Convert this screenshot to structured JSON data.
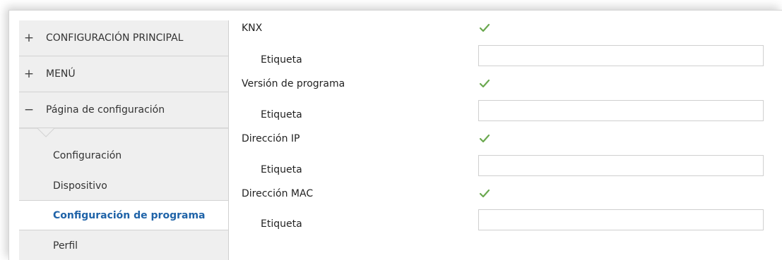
{
  "sidebar": {
    "groups": [
      {
        "sign": "+",
        "label": "CONFIGURACIÓN PRINCIPAL"
      },
      {
        "sign": "+",
        "label": "MENÚ"
      },
      {
        "sign": "−",
        "label": "Página de configuración"
      }
    ],
    "items": [
      {
        "label": "Configuración"
      },
      {
        "label": "Dispositivo"
      },
      {
        "label": "Configuración de programa"
      },
      {
        "label": "Perfil"
      }
    ]
  },
  "settings": [
    {
      "label": "KNX",
      "checked": true,
      "tag_label": "Etiqueta",
      "tag_value": ""
    },
    {
      "label": "Versión de programa",
      "checked": true,
      "tag_label": "Etiqueta",
      "tag_value": ""
    },
    {
      "label": "Dirección IP",
      "checked": true,
      "tag_label": "Etiqueta",
      "tag_value": ""
    },
    {
      "label": "Dirección MAC",
      "checked": true,
      "tag_label": "Etiqueta",
      "tag_value": ""
    }
  ],
  "colors": {
    "accent": "#1f63a8",
    "check": "#6aa84f",
    "sidebar_bg": "#efefef"
  }
}
